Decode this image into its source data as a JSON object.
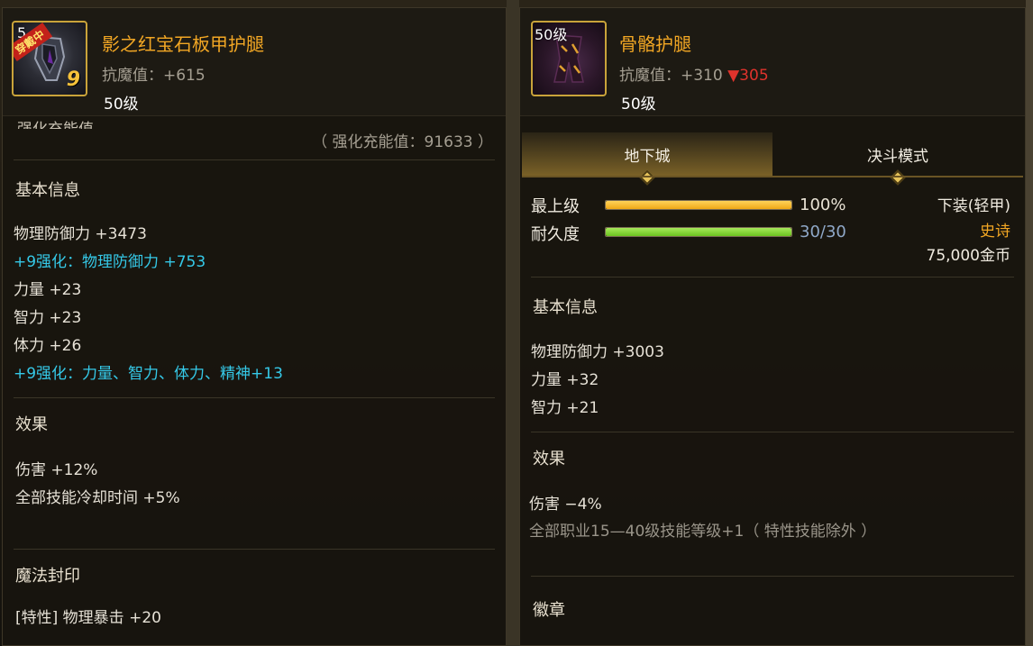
{
  "left_panel": {
    "icon": {
      "level_partial": "5",
      "equip_tag": "穿戴中",
      "enhance": "9"
    },
    "name": "影之红宝石板甲护腿",
    "resist": "抗魔值：+615",
    "level": "50级",
    "charge_label_partial": "强化充能值",
    "charge_value": "（ 强化充能值：91633 ）",
    "sections": {
      "basic": {
        "title": "基本信息",
        "lines": [
          "物理防御力 +3473",
          "+9强化：物理防御力 +753",
          "力量 +23",
          "智力 +23",
          "体力 +26",
          "+9强化：力量、智力、体力、精神+13"
        ]
      },
      "effect": {
        "title": "效果",
        "lines": [
          "伤害 +12%",
          "全部技能冷却时间 +5%"
        ]
      },
      "seal": {
        "title": "魔法封印",
        "lines": [
          "[特性] 物理暴击 +20"
        ]
      }
    }
  },
  "right_panel": {
    "icon": {
      "level": "50级"
    },
    "name": "骨骼护腿",
    "resist_prefix": "抗魔值：+310 ",
    "resist_diff": "▼305",
    "level": "50级",
    "tabs": [
      {
        "label": "地下城",
        "active": true
      },
      {
        "label": "决斗模式",
        "active": false
      }
    ],
    "grade": {
      "label": "最上级",
      "value": "100%",
      "fill_fraction": 1.0,
      "color": "#f0a817"
    },
    "durability": {
      "label": "耐久度",
      "value": "30/30",
      "fill_fraction": 1.0,
      "color": "#6cc31f"
    },
    "type": "下装(轻甲)",
    "rarity": "史诗",
    "price": "75,000金币",
    "sections": {
      "basic": {
        "title": "基本信息",
        "lines": [
          "物理防御力 +3003",
          "力量 +32",
          "智力 +21"
        ]
      },
      "effect": {
        "title": "效果",
        "lines": [
          "伤害 −4%",
          "全部职业15—40级技能等级+1（ 特性技能除外 ）"
        ]
      },
      "emblem": {
        "title": "徽章"
      }
    }
  },
  "colors": {
    "item_name": "#f2a724",
    "enhance_text": "#35c9e8",
    "down_arrow": "#e0332c",
    "rarity_epic": "#f2a724"
  }
}
